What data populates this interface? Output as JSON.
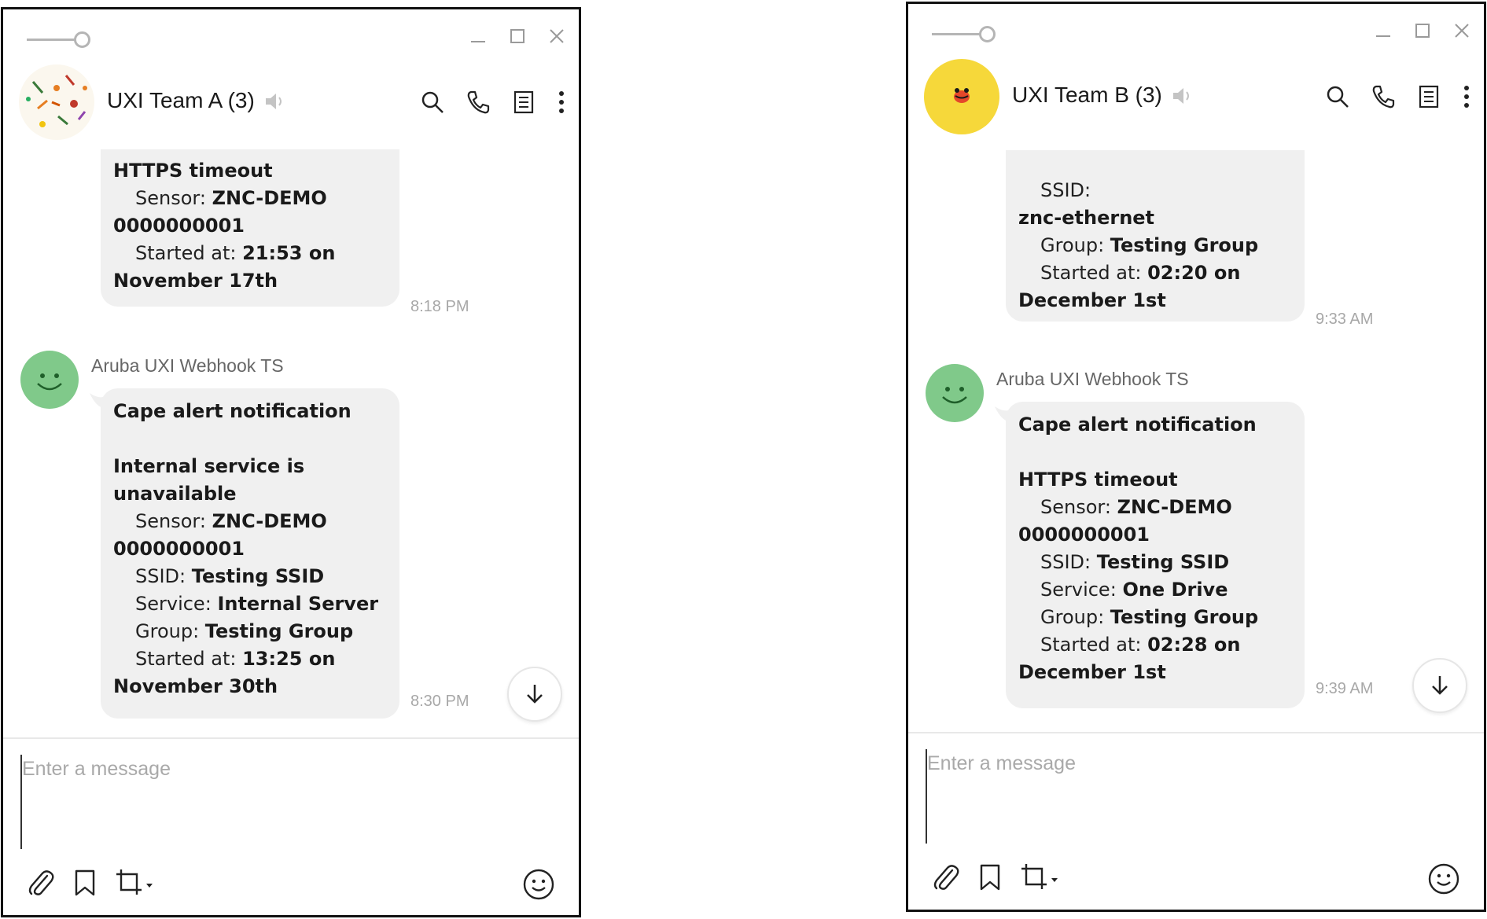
{
  "windows": [
    {
      "chat_title": "UXI Team A (3)",
      "composer_placeholder": "Enter a message",
      "first_message": {
        "time": "8:18 PM",
        "lines": [
          {
            "label": "",
            "value": "HTTPS timeout"
          },
          {
            "label": "Sensor:",
            "value": "ZNC-DEMO"
          },
          {
            "label": "",
            "value": "0000000001"
          },
          {
            "label": "Started at:",
            "value": "21:53 on"
          },
          {
            "label": "",
            "value": "November 17th"
          }
        ]
      },
      "second_message": {
        "sender": "Aruba UXI Webhook TS",
        "time": "8:30 PM",
        "lines": [
          {
            "label": "",
            "value": "Cape alert notification"
          },
          {
            "label": "",
            "value": ""
          },
          {
            "label": "",
            "value": "Internal service is"
          },
          {
            "label": "",
            "value": "unavailable"
          },
          {
            "label": "Sensor:",
            "value": "ZNC-DEMO"
          },
          {
            "label": "",
            "value": "0000000001"
          },
          {
            "label": "SSID:",
            "value": "Testing SSID"
          },
          {
            "label": "Service:",
            "value": "Internal Server"
          },
          {
            "label": "Group:",
            "value": "Testing Group"
          },
          {
            "label": "Started at:",
            "value": "13:25 on"
          },
          {
            "label": "",
            "value": "November 30th"
          }
        ]
      }
    },
    {
      "chat_title": "UXI Team B (3)",
      "composer_placeholder": "Enter a message",
      "first_message": {
        "time": "9:33 AM",
        "lines": [
          {
            "label": "SSID:",
            "value": ""
          },
          {
            "label": "",
            "value": "znc-ethernet"
          },
          {
            "label": "Group:",
            "value": "Testing Group"
          },
          {
            "label": "Started at:",
            "value": "02:20 on"
          },
          {
            "label": "",
            "value": "December 1st"
          }
        ]
      },
      "second_message": {
        "sender": "Aruba UXI Webhook TS",
        "time": "9:39 AM",
        "lines": [
          {
            "label": "",
            "value": "Cape alert notification"
          },
          {
            "label": "",
            "value": ""
          },
          {
            "label": "",
            "value": "HTTPS timeout"
          },
          {
            "label": "Sensor:",
            "value": "ZNC-DEMO"
          },
          {
            "label": "",
            "value": "0000000001"
          },
          {
            "label": "SSID:",
            "value": "Testing SSID"
          },
          {
            "label": "Service:",
            "value": "One Drive"
          },
          {
            "label": "Group:",
            "value": "Testing Group"
          },
          {
            "label": "Started at:",
            "value": "02:28 on"
          },
          {
            "label": "",
            "value": "December 1st"
          }
        ]
      }
    }
  ],
  "icons": {
    "opacity_slider": "opacity-slider-icon",
    "minimize": "minimize-icon",
    "maximize": "maximize-icon",
    "close": "close-icon",
    "mute": "speaker-muted-icon",
    "search": "search-icon",
    "call": "phone-icon",
    "notes": "notes-icon",
    "more": "more-vertical-icon",
    "scroll_down": "arrow-down-icon",
    "attach": "paperclip-icon",
    "bookmark": "bookmark-icon",
    "capture": "crop-icon",
    "emoji": "smiley-icon"
  },
  "colors": {
    "bubble": "#f0f0f0",
    "bot_avatar": "#80c98a",
    "team_b_avatar": "#f6d83a",
    "timestamp": "#a8a8a8"
  }
}
